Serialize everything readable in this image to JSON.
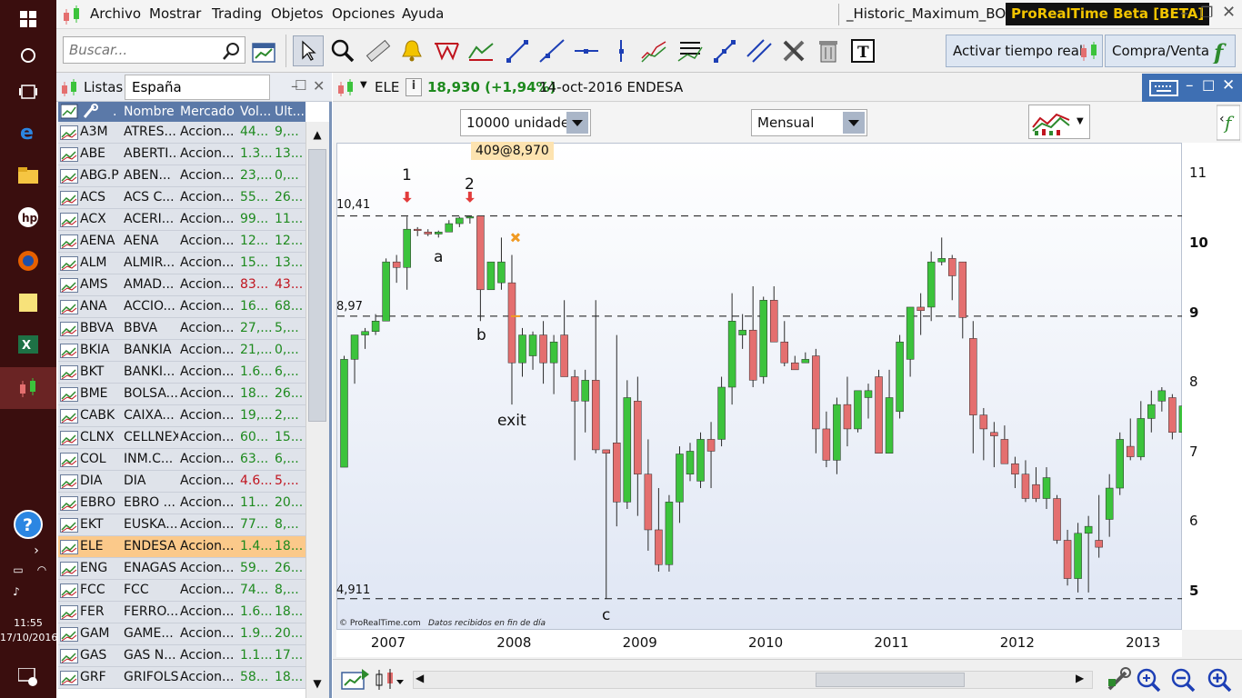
{
  "taskbar": {
    "time": "11:55",
    "date": "17/10/2016"
  },
  "menu": {
    "items": [
      "Archivo",
      "Mostrar",
      "Trading",
      "Objetos",
      "Opciones",
      "Ayuda"
    ],
    "window_title": "_Historic_Maximum_BO",
    "app_badge": "ProRealTime Beta [BETA]"
  },
  "toolbar": {
    "search_placeholder": "Buscar...",
    "realtime_label": "Activar tiempo real",
    "buysell_label": "Compra/Venta"
  },
  "list": {
    "title": "Listas",
    "selector": "España",
    "columns": [
      ".",
      "Nombre",
      "Mercado",
      "Vol...",
      "Ult..."
    ],
    "rows": [
      {
        "ticker": "A3M",
        "name": "ATRES...",
        "market": "Accion...",
        "vol": "44...",
        "last": "9,...",
        "dir": "pos"
      },
      {
        "ticker": "ABE",
        "name": "ABERTI...",
        "market": "Accion...",
        "vol": "1.3...",
        "last": "13...",
        "dir": "pos"
      },
      {
        "ticker": "ABG.P",
        "name": "ABEN...",
        "market": "Accion...",
        "vol": "23,...",
        "last": "0,...",
        "dir": "pos"
      },
      {
        "ticker": "ACS",
        "name": "ACS C...",
        "market": "Accion...",
        "vol": "55...",
        "last": "26...",
        "dir": "pos"
      },
      {
        "ticker": "ACX",
        "name": "ACERI...",
        "market": "Accion...",
        "vol": "99...",
        "last": "11...",
        "dir": "pos"
      },
      {
        "ticker": "AENA",
        "name": "AENA",
        "market": "Accion...",
        "vol": "12...",
        "last": "12...",
        "dir": "pos"
      },
      {
        "ticker": "ALM",
        "name": "ALMIR...",
        "market": "Accion...",
        "vol": "15...",
        "last": "13...",
        "dir": "pos"
      },
      {
        "ticker": "AMS",
        "name": "AMAD...",
        "market": "Accion...",
        "vol": "83...",
        "last": "43...",
        "dir": "neg"
      },
      {
        "ticker": "ANA",
        "name": "ACCIO...",
        "market": "Accion...",
        "vol": "16...",
        "last": "68...",
        "dir": "pos"
      },
      {
        "ticker": "BBVA",
        "name": "BBVA",
        "market": "Accion...",
        "vol": "27,...",
        "last": "5,...",
        "dir": "pos"
      },
      {
        "ticker": "BKIA",
        "name": "BANKIA",
        "market": "Accion...",
        "vol": "21,...",
        "last": "0,...",
        "dir": "pos"
      },
      {
        "ticker": "BKT",
        "name": "BANKI...",
        "market": "Accion...",
        "vol": "1.6...",
        "last": "6,...",
        "dir": "pos"
      },
      {
        "ticker": "BME",
        "name": "BOLSA...",
        "market": "Accion...",
        "vol": "18...",
        "last": "26...",
        "dir": "pos"
      },
      {
        "ticker": "CABK",
        "name": "CAIXA...",
        "market": "Accion...",
        "vol": "19,...",
        "last": "2,...",
        "dir": "pos"
      },
      {
        "ticker": "CLNX",
        "name": "CELLNEX",
        "market": "Accion...",
        "vol": "60...",
        "last": "15...",
        "dir": "pos"
      },
      {
        "ticker": "COL",
        "name": "INM.C...",
        "market": "Accion...",
        "vol": "63...",
        "last": "6,...",
        "dir": "pos"
      },
      {
        "ticker": "DIA",
        "name": "DIA",
        "market": "Accion...",
        "vol": "4.6...",
        "last": "5,...",
        "dir": "neg"
      },
      {
        "ticker": "EBRO",
        "name": "EBRO ...",
        "market": "Accion...",
        "vol": "11...",
        "last": "20...",
        "dir": "pos"
      },
      {
        "ticker": "EKT",
        "name": "EUSKA...",
        "market": "Accion...",
        "vol": "77...",
        "last": "8,...",
        "dir": "pos"
      },
      {
        "ticker": "ELE",
        "name": "ENDESA",
        "market": "Accion...",
        "vol": "1.4...",
        "last": "18...",
        "dir": "pos"
      },
      {
        "ticker": "ENG",
        "name": "ENAGAS",
        "market": "Accion...",
        "vol": "59...",
        "last": "26...",
        "dir": "pos"
      },
      {
        "ticker": "FCC",
        "name": "FCC",
        "market": "Accion...",
        "vol": "74...",
        "last": "8,...",
        "dir": "pos"
      },
      {
        "ticker": "FER",
        "name": "FERRO...",
        "market": "Accion...",
        "vol": "1.6...",
        "last": "18...",
        "dir": "pos"
      },
      {
        "ticker": "GAM",
        "name": "GAME...",
        "market": "Accion...",
        "vol": "1.9...",
        "last": "20...",
        "dir": "pos"
      },
      {
        "ticker": "GAS",
        "name": "GAS N...",
        "market": "Accion...",
        "vol": "1.1...",
        "last": "17...",
        "dir": "pos"
      },
      {
        "ticker": "GRF",
        "name": "GRIFOLS",
        "market": "Accion...",
        "vol": "58...",
        "last": "18...",
        "dir": "pos"
      }
    ]
  },
  "chart_window": {
    "ticker": "ELE",
    "price": "18,930 (+1,94%)",
    "date_name": "14-oct-2016 ENDESA",
    "units": "10000 unidades",
    "period": "Mensual",
    "order_label": "409@8,970",
    "watermark": "© ProRealTime.com",
    "watermark_note": "Datos recibidos en fin de día",
    "level_labels": [
      "10,41",
      "8,97",
      "4,911"
    ],
    "annotations": [
      "1",
      "2",
      "a",
      "b",
      "exit",
      "c"
    ]
  },
  "chart_data": {
    "type": "candlestick",
    "y_ticks": [
      11,
      10,
      9,
      8,
      7,
      6,
      5
    ],
    "ylim": [
      4.45,
      11.45
    ],
    "x_ticks": [
      "2007",
      "2008",
      "2009",
      "2010",
      "2011",
      "2012",
      "2013"
    ],
    "horizontal_levels": [
      10.41,
      8.97,
      4.911
    ],
    "colors": {
      "up": "#3cc33c",
      "down": "#e46f6f"
    },
    "series": [
      {
        "o": 6.8,
        "h": 8.4,
        "l": 6.8,
        "c": 8.35
      },
      {
        "o": 8.35,
        "h": 8.7,
        "l": 8.0,
        "c": 8.7
      },
      {
        "o": 8.7,
        "h": 8.8,
        "l": 8.5,
        "c": 8.75
      },
      {
        "o": 8.75,
        "h": 9.0,
        "l": 8.7,
        "c": 8.9
      },
      {
        "o": 8.9,
        "h": 9.8,
        "l": 8.9,
        "c": 9.75
      },
      {
        "o": 9.75,
        "h": 9.85,
        "l": 9.45,
        "c": 9.67
      },
      {
        "o": 9.67,
        "h": 10.4,
        "l": 9.35,
        "c": 10.22
      },
      {
        "o": 10.22,
        "h": 10.25,
        "l": 10.12,
        "c": 10.2
      },
      {
        "o": 10.18,
        "h": 10.22,
        "l": 10.12,
        "c": 10.15
      },
      {
        "o": 10.15,
        "h": 10.2,
        "l": 10.1,
        "c": 10.18
      },
      {
        "o": 10.18,
        "h": 10.35,
        "l": 10.18,
        "c": 10.3
      },
      {
        "o": 10.3,
        "h": 10.4,
        "l": 10.25,
        "c": 10.38
      },
      {
        "o": 10.38,
        "h": 10.41,
        "l": 10.3,
        "c": 10.4
      },
      {
        "o": 10.41,
        "h": 10.41,
        "l": 8.9,
        "c": 9.35
      },
      {
        "o": 9.35,
        "h": 9.75,
        "l": 9.35,
        "c": 9.75
      },
      {
        "o": 9.45,
        "h": 10.1,
        "l": 9.35,
        "c": 9.75
      },
      {
        "o": 9.45,
        "h": 9.85,
        "l": 7.7,
        "c": 8.3
      },
      {
        "o": 8.3,
        "h": 8.8,
        "l": 8.1,
        "c": 8.7
      },
      {
        "o": 8.4,
        "h": 8.75,
        "l": 8.2,
        "c": 8.7
      },
      {
        "o": 8.7,
        "h": 8.9,
        "l": 8.0,
        "c": 8.3
      },
      {
        "o": 8.3,
        "h": 8.7,
        "l": 7.85,
        "c": 8.6
      },
      {
        "o": 8.7,
        "h": 9.2,
        "l": 8.1,
        "c": 8.1
      },
      {
        "o": 8.1,
        "h": 8.2,
        "l": 6.9,
        "c": 7.75
      },
      {
        "o": 7.75,
        "h": 8.2,
        "l": 7.3,
        "c": 8.05
      },
      {
        "o": 8.05,
        "h": 9.2,
        "l": 7.0,
        "c": 7.05
      },
      {
        "o": 7.05,
        "h": 7.05,
        "l": 4.91,
        "c": 7.0
      },
      {
        "o": 7.15,
        "h": 8.7,
        "l": 5.95,
        "c": 6.3
      },
      {
        "o": 6.3,
        "h": 8.05,
        "l": 6.2,
        "c": 7.8
      },
      {
        "o": 7.75,
        "h": 8.1,
        "l": 6.1,
        "c": 6.7
      },
      {
        "o": 6.7,
        "h": 7.2,
        "l": 5.6,
        "c": 5.9
      },
      {
        "o": 5.9,
        "h": 6.5,
        "l": 5.3,
        "c": 5.4
      },
      {
        "o": 5.4,
        "h": 6.4,
        "l": 5.3,
        "c": 6.3
      },
      {
        "o": 6.3,
        "h": 7.1,
        "l": 6.0,
        "c": 6.99
      },
      {
        "o": 6.7,
        "h": 7.15,
        "l": 6.6,
        "c": 7.03
      },
      {
        "o": 6.6,
        "h": 7.3,
        "l": 6.5,
        "c": 7.2
      },
      {
        "o": 7.2,
        "h": 7.45,
        "l": 6.5,
        "c": 7.03
      },
      {
        "o": 7.2,
        "h": 8.1,
        "l": 7.1,
        "c": 7.95
      },
      {
        "o": 7.95,
        "h": 9.3,
        "l": 7.7,
        "c": 8.9
      },
      {
        "o": 8.7,
        "h": 9.0,
        "l": 8.5,
        "c": 8.77
      },
      {
        "o": 8.77,
        "h": 9.4,
        "l": 7.95,
        "c": 8.05
      },
      {
        "o": 8.1,
        "h": 9.25,
        "l": 8.0,
        "c": 9.2
      },
      {
        "o": 9.2,
        "h": 9.4,
        "l": 8.6,
        "c": 8.6
      },
      {
        "o": 8.6,
        "h": 8.9,
        "l": 8.25,
        "c": 8.3
      },
      {
        "o": 8.3,
        "h": 8.4,
        "l": 8.2,
        "c": 8.2
      },
      {
        "o": 8.3,
        "h": 8.45,
        "l": 8.3,
        "c": 8.35
      },
      {
        "o": 8.4,
        "h": 8.5,
        "l": 7.0,
        "c": 7.35
      },
      {
        "o": 7.35,
        "h": 7.6,
        "l": 6.8,
        "c": 6.9
      },
      {
        "o": 6.9,
        "h": 7.8,
        "l": 6.7,
        "c": 7.7
      },
      {
        "o": 7.7,
        "h": 8.1,
        "l": 7.1,
        "c": 7.35
      },
      {
        "o": 7.35,
        "h": 7.85,
        "l": 7.3,
        "c": 7.9
      },
      {
        "o": 7.8,
        "h": 8.0,
        "l": 7.5,
        "c": 7.9
      },
      {
        "o": 8.1,
        "h": 8.2,
        "l": 7.0,
        "c": 7.0
      },
      {
        "o": 7.0,
        "h": 8.2,
        "l": 7.0,
        "c": 7.8
      },
      {
        "o": 7.6,
        "h": 8.7,
        "l": 7.5,
        "c": 8.6
      },
      {
        "o": 8.35,
        "h": 9.1,
        "l": 8.1,
        "c": 9.1
      },
      {
        "o": 9.1,
        "h": 9.3,
        "l": 8.7,
        "c": 9.05
      },
      {
        "o": 9.1,
        "h": 9.9,
        "l": 8.9,
        "c": 9.75
      },
      {
        "o": 9.75,
        "h": 10.1,
        "l": 9.7,
        "c": 9.8
      },
      {
        "o": 9.8,
        "h": 9.85,
        "l": 9.2,
        "c": 9.55
      },
      {
        "o": 9.75,
        "h": 9.75,
        "l": 8.65,
        "c": 8.95
      },
      {
        "o": 8.65,
        "h": 8.9,
        "l": 7.0,
        "c": 7.55
      },
      {
        "o": 7.55,
        "h": 7.65,
        "l": 6.9,
        "c": 7.35
      },
      {
        "o": 7.3,
        "h": 7.45,
        "l": 6.8,
        "c": 7.25
      },
      {
        "o": 7.2,
        "h": 7.4,
        "l": 6.9,
        "c": 6.85
      },
      {
        "o": 6.85,
        "h": 6.95,
        "l": 6.5,
        "c": 6.7
      },
      {
        "o": 6.7,
        "h": 6.9,
        "l": 6.3,
        "c": 6.35
      },
      {
        "o": 6.55,
        "h": 6.8,
        "l": 6.3,
        "c": 6.35
      },
      {
        "o": 6.35,
        "h": 6.8,
        "l": 6.2,
        "c": 6.65
      },
      {
        "o": 6.35,
        "h": 6.4,
        "l": 5.7,
        "c": 5.75
      },
      {
        "o": 5.75,
        "h": 5.9,
        "l": 5.1,
        "c": 5.2
      },
      {
        "o": 5.2,
        "h": 6.0,
        "l": 5.0,
        "c": 5.85
      },
      {
        "o": 5.85,
        "h": 6.1,
        "l": 5.0,
        "c": 5.95
      },
      {
        "o": 5.75,
        "h": 6.4,
        "l": 5.5,
        "c": 5.65
      },
      {
        "o": 6.05,
        "h": 6.7,
        "l": 5.8,
        "c": 6.5
      },
      {
        "o": 6.5,
        "h": 7.3,
        "l": 6.4,
        "c": 7.2
      },
      {
        "o": 7.1,
        "h": 7.5,
        "l": 6.9,
        "c": 6.95
      },
      {
        "o": 6.95,
        "h": 7.75,
        "l": 6.9,
        "c": 7.5
      },
      {
        "o": 7.5,
        "h": 7.9,
        "l": 7.3,
        "c": 7.7
      },
      {
        "o": 7.75,
        "h": 7.95,
        "l": 7.6,
        "c": 7.9
      },
      {
        "o": 7.8,
        "h": 7.85,
        "l": 7.2,
        "c": 7.3
      },
      {
        "o": 7.3,
        "h": 8.7,
        "l": 7.1,
        "c": 7.68
      }
    ]
  }
}
